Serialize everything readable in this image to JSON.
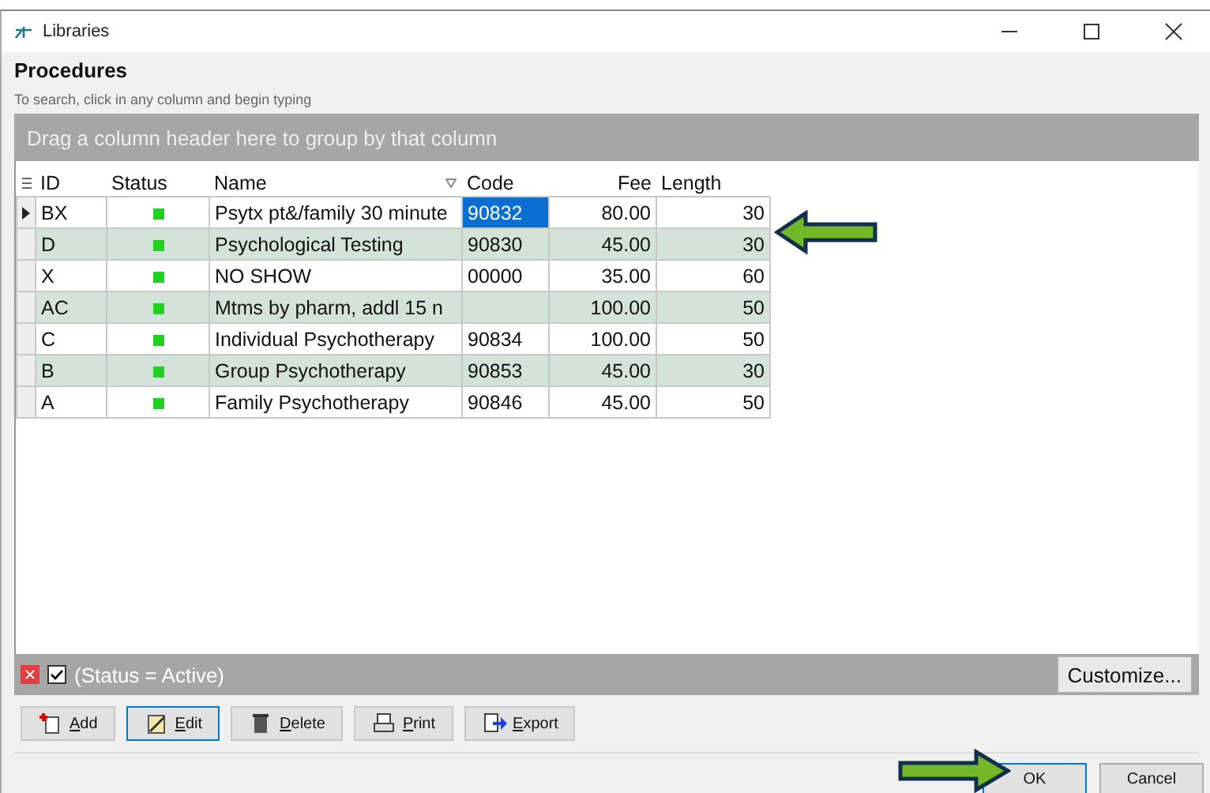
{
  "window": {
    "title": "Libraries"
  },
  "header": {
    "title": "Procedures",
    "hint": "To search, click in any column and begin typing"
  },
  "group_panel": {
    "text": "Drag a column header here to group by that column"
  },
  "table": {
    "columns": [
      {
        "label": "ID",
        "sorted": false
      },
      {
        "label": "Status",
        "sorted": false
      },
      {
        "label": "Name",
        "sorted": true
      },
      {
        "label": "Code",
        "sorted": false
      },
      {
        "label": "Fee",
        "sorted": false
      },
      {
        "label": "Length",
        "sorted": false
      }
    ],
    "rows": [
      {
        "selected": true,
        "id": "BX",
        "active": true,
        "name": "Psytx pt&/family 30 minute",
        "code": "90832",
        "fee": "80.00",
        "length": "30"
      },
      {
        "selected": false,
        "id": "D",
        "active": true,
        "name": "Psychological Testing",
        "code": "90830",
        "fee": "45.00",
        "length": "30"
      },
      {
        "selected": false,
        "id": "X",
        "active": true,
        "name": "NO SHOW",
        "code": "00000",
        "fee": "35.00",
        "length": "60"
      },
      {
        "selected": false,
        "id": "AC",
        "active": true,
        "name": "Mtms by pharm, addl 15 n",
        "code": "",
        "fee": "100.00",
        "length": "50"
      },
      {
        "selected": false,
        "id": "C",
        "active": true,
        "name": "Individual Psychotherapy",
        "code": "90834",
        "fee": "100.00",
        "length": "50"
      },
      {
        "selected": false,
        "id": "B",
        "active": true,
        "name": "Group Psychotherapy",
        "code": "90853",
        "fee": "45.00",
        "length": "30"
      },
      {
        "selected": false,
        "id": "A",
        "active": true,
        "name": "Family Psychotherapy",
        "code": "90846",
        "fee": "45.00",
        "length": "50"
      }
    ]
  },
  "filter_bar": {
    "checked": true,
    "text": "(Status = Active)",
    "customize": "Customize..."
  },
  "toolbar": [
    {
      "kind": "add",
      "label": "Add",
      "focused": false
    },
    {
      "kind": "edit",
      "label": "Edit",
      "focused": true
    },
    {
      "kind": "delete",
      "label": "Delete",
      "focused": false
    },
    {
      "kind": "print",
      "label": "Print",
      "focused": false
    },
    {
      "kind": "export",
      "label": "Export",
      "focused": false
    }
  ],
  "dialog_buttons": [
    {
      "label": "OK",
      "focused": true
    },
    {
      "label": "Cancel",
      "focused": false
    }
  ]
}
